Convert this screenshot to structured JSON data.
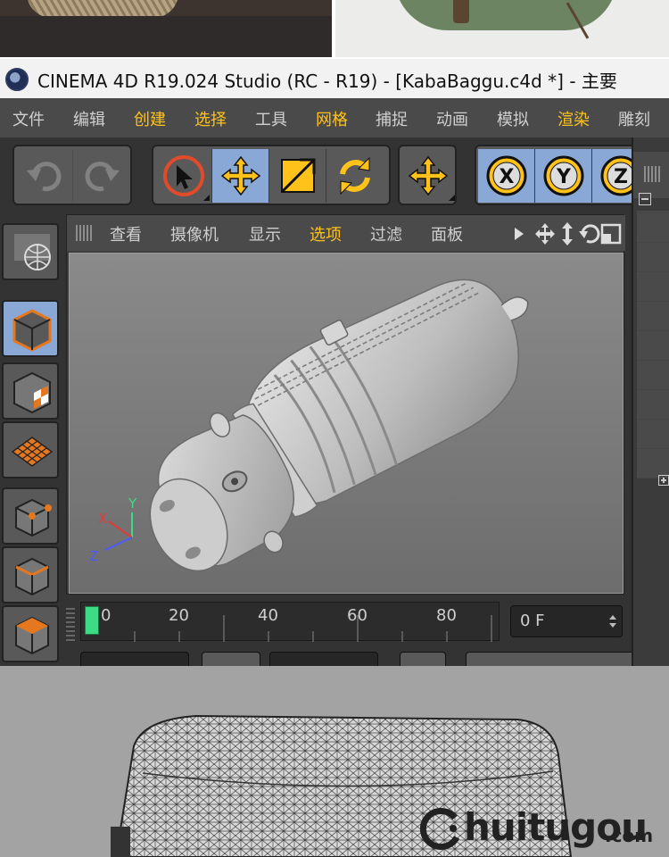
{
  "window": {
    "title": "CINEMA 4D R19.024 Studio (RC - R19) - [KabaBaggu.c4d *] - 主要"
  },
  "menu": {
    "items": [
      {
        "label": "文件",
        "highlight": false
      },
      {
        "label": "编辑",
        "highlight": false
      },
      {
        "label": "创建",
        "highlight": true
      },
      {
        "label": "选择",
        "highlight": true
      },
      {
        "label": "工具",
        "highlight": false
      },
      {
        "label": "网格",
        "highlight": true
      },
      {
        "label": "捕捉",
        "highlight": false
      },
      {
        "label": "动画",
        "highlight": false
      },
      {
        "label": "模拟",
        "highlight": false
      },
      {
        "label": "渲染",
        "highlight": true
      },
      {
        "label": "雕刻",
        "highlight": false
      }
    ]
  },
  "toolbar": {
    "icons": [
      "undo-icon",
      "redo-icon",
      "live-selection-icon",
      "move-icon",
      "scale-icon",
      "rotate-icon",
      "move-tool-icon",
      "x-axis-icon",
      "y-axis-icon",
      "z-axis-icon"
    ],
    "axes": [
      "X",
      "Y",
      "Z"
    ]
  },
  "viewport_menu": {
    "items": [
      {
        "label": "查看",
        "highlight": false
      },
      {
        "label": "摄像机",
        "highlight": false
      },
      {
        "label": "显示",
        "highlight": false
      },
      {
        "label": "选项",
        "highlight": true
      },
      {
        "label": "过滤",
        "highlight": false
      },
      {
        "label": "面板",
        "highlight": false
      }
    ]
  },
  "axis_gizmo": {
    "x": "X",
    "y": "Y",
    "z": "Z"
  },
  "timeline": {
    "ticks": [
      "0",
      "20",
      "40",
      "60",
      "80"
    ],
    "current_frame": "0 F"
  },
  "colors": {
    "accent": "#ffc21a",
    "active_button": "#8aa8d6",
    "playhead": "#3ddc84"
  },
  "watermark": {
    "text": "huitugou",
    "domain": ".com"
  }
}
